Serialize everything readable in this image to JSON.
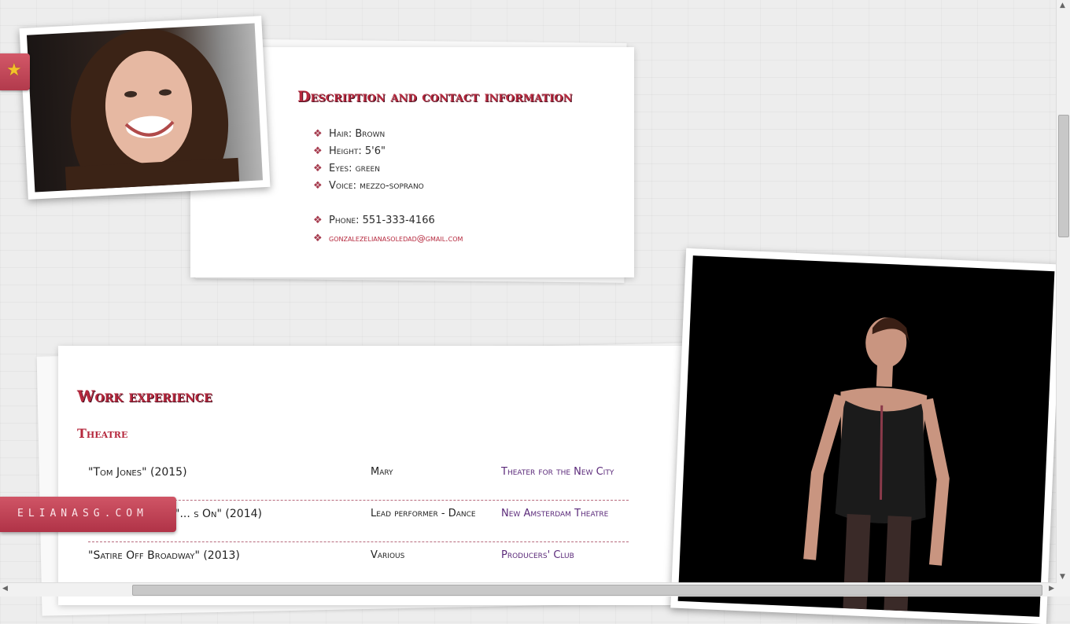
{
  "description": {
    "title": "Description and contact information",
    "items": [
      {
        "label": "Hair:",
        "value": "Brown"
      },
      {
        "label": "Height:",
        "value": "5'6\""
      },
      {
        "label": "Eyes:",
        "value": "green"
      },
      {
        "label": "Voice:",
        "value": "mezzo-soprano"
      }
    ],
    "phone": {
      "label": "Phone:",
      "value": "551-333-4166"
    },
    "email": "gonzalezelianasoledad@gmail.com"
  },
  "work": {
    "title": "Work experience",
    "section": "Theatre",
    "rows": [
      {
        "show": "\"Tom Jones\" (2015)",
        "role": "Mary",
        "venue": "Theater for the New City"
      },
      {
        "show": "\"... s On\" (2014)",
        "role": "Lead performer - Dance",
        "venue": "New Amsterdam Theatre"
      },
      {
        "show": "\"Satire Off Broadway\" (2013)",
        "role": "Various",
        "venue": "Producers' Club"
      }
    ]
  },
  "site_badge": "ELIANASG.COM",
  "colors": {
    "accent": "#b5283d",
    "link": "#5b2a7a",
    "tab": "#c24a5a"
  },
  "icons": {
    "favorite": "star-icon"
  }
}
